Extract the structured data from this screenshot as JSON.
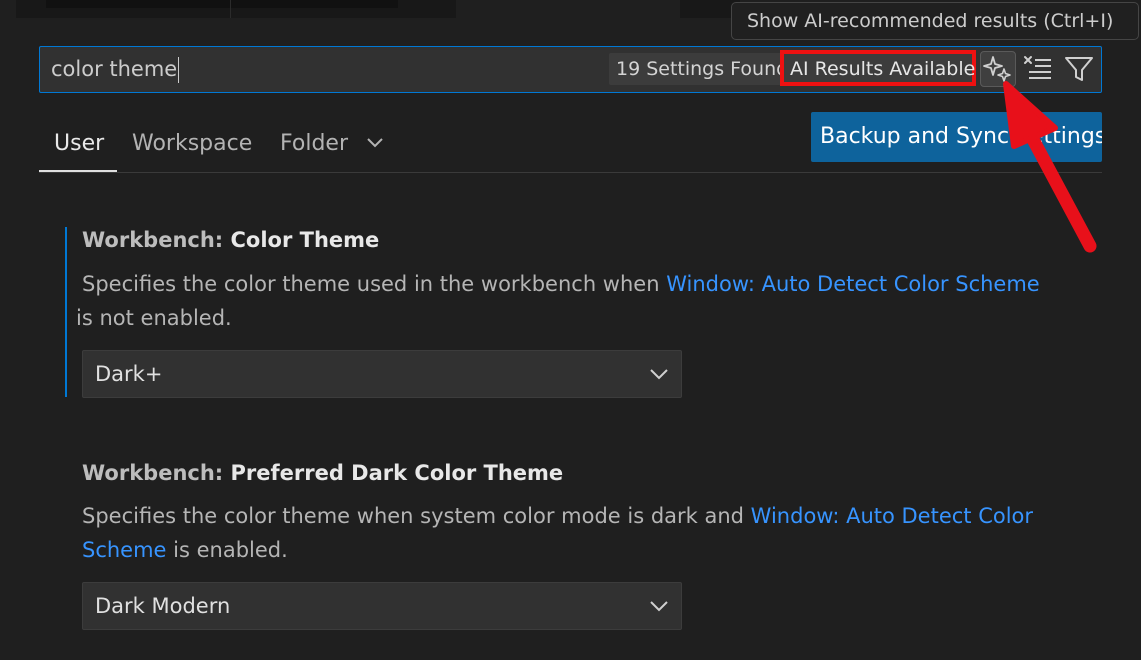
{
  "tooltip": {
    "text": "Show AI-recommended results (Ctrl+I)"
  },
  "search": {
    "value": "color theme",
    "count_label": "19 Settings Found",
    "ai_label": "AI Results Available"
  },
  "icons": {
    "ai": "sparkle-icon",
    "clear": "clear-filter-icon",
    "filter": "filter-icon",
    "dropdown": "chevron-down-icon"
  },
  "tabs": [
    {
      "label": "User",
      "active": true
    },
    {
      "label": "Workspace",
      "active": false
    },
    {
      "label": "Folder",
      "active": false
    }
  ],
  "sync_button": {
    "label": "Backup and Sync Settings"
  },
  "settings": [
    {
      "category": "Workbench: ",
      "name": "Color Theme",
      "desc_before": "Specifies the color theme used in the workbench when ",
      "desc_link": "Window: Auto Detect Color Scheme",
      "desc_after": " is not enabled.",
      "value": "Dark+"
    },
    {
      "category": "Workbench: ",
      "name": "Preferred Dark Color Theme",
      "desc_before": "Specifies the color theme when system color mode is dark and ",
      "desc_link": "Window: Auto Detect Color Scheme",
      "desc_after": " is enabled.",
      "value": "Dark Modern"
    }
  ],
  "colors": {
    "background": "#1f1f1f",
    "accent": "#0078d4",
    "link": "#3794ff",
    "highlight_red": "#ee1111",
    "button": "#0e639c"
  }
}
